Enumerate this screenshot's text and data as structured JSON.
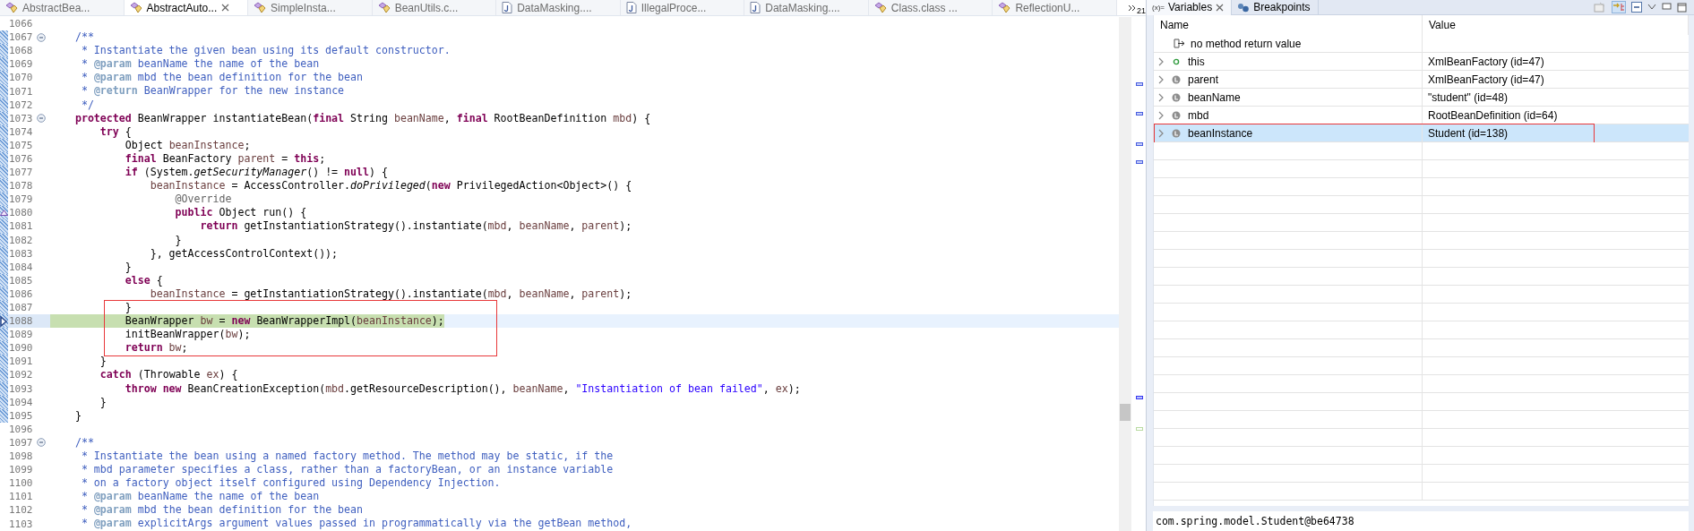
{
  "editor_tabs": [
    {
      "label": "AbstractBea...",
      "kind": "class",
      "selected": false
    },
    {
      "label": "AbstractAuto...",
      "kind": "class",
      "selected": true
    },
    {
      "label": "SimpleInsta...",
      "kind": "class",
      "selected": false
    },
    {
      "label": "BeanUtils.c...",
      "kind": "class",
      "selected": false
    },
    {
      "label": "DataMasking....",
      "kind": "java",
      "selected": false
    },
    {
      "label": "IllegalProce...",
      "kind": "java",
      "selected": false
    },
    {
      "label": "DataMasking....",
      "kind": "java",
      "selected": false
    },
    {
      "label": "Class.class ...",
      "kind": "class",
      "selected": false
    },
    {
      "label": "ReflectionU...",
      "kind": "class",
      "selected": false
    }
  ],
  "overflow_count": "21",
  "editor": {
    "lines": [
      {
        "number": "1066",
        "fold": false,
        "in_range": false,
        "current": false
      },
      {
        "number": "1067",
        "tokens": [
          {
            "kind": "comment",
            "text": "    /**"
          }
        ],
        "fold": true,
        "in_range": true,
        "current": false
      },
      {
        "number": "1068",
        "tokens": [
          {
            "kind": "comment",
            "text": "     * Instantiate the given bean using its default constructor."
          }
        ],
        "fold": false,
        "in_range": true,
        "current": false
      },
      {
        "number": "1069",
        "tokens": [
          {
            "kind": "comment",
            "text": "     * "
          },
          {
            "kind": "tag",
            "text": "@param"
          },
          {
            "kind": "comment",
            "text": " beanName the name of the bean"
          }
        ],
        "fold": false,
        "in_range": true,
        "current": false
      },
      {
        "number": "1070",
        "tokens": [
          {
            "kind": "comment",
            "text": "     * "
          },
          {
            "kind": "tag",
            "text": "@param"
          },
          {
            "kind": "comment",
            "text": " mbd the bean definition for the bean"
          }
        ],
        "fold": false,
        "in_range": true,
        "current": false
      },
      {
        "number": "1071",
        "tokens": [
          {
            "kind": "comment",
            "text": "     * "
          },
          {
            "kind": "tag",
            "text": "@return"
          },
          {
            "kind": "comment",
            "text": " BeanWrapper for the new instance"
          }
        ],
        "fold": false,
        "in_range": true,
        "current": false
      },
      {
        "number": "1072",
        "tokens": [
          {
            "kind": "comment",
            "text": "     */"
          }
        ],
        "fold": false,
        "in_range": true,
        "current": false
      },
      {
        "number": "1073",
        "tokens": [
          {
            "kind": "keyword",
            "text": "    protected"
          },
          {
            "kind": "plain",
            "text": " BeanWrapper instantiateBean("
          },
          {
            "kind": "keyword",
            "text": "final"
          },
          {
            "kind": "plain",
            "text": " String "
          },
          {
            "kind": "var",
            "text": "beanName"
          },
          {
            "kind": "plain",
            "text": ", "
          },
          {
            "kind": "keyword",
            "text": "final"
          },
          {
            "kind": "plain",
            "text": " RootBeanDefinition "
          },
          {
            "kind": "var",
            "text": "mbd"
          },
          {
            "kind": "plain",
            "text": ") {"
          }
        ],
        "fold": true,
        "in_range": true,
        "current": false
      },
      {
        "number": "1074",
        "tokens": [
          {
            "kind": "keyword",
            "text": "        try"
          },
          {
            "kind": "plain",
            "text": " {"
          }
        ],
        "fold": false,
        "in_range": true,
        "current": false
      },
      {
        "number": "1075",
        "tokens": [
          {
            "kind": "plain",
            "text": "            Object "
          },
          {
            "kind": "var",
            "text": "beanInstance"
          },
          {
            "kind": "plain",
            "text": ";"
          }
        ],
        "fold": false,
        "in_range": true,
        "current": false
      },
      {
        "number": "1076",
        "tokens": [
          {
            "kind": "keyword",
            "text": "            final"
          },
          {
            "kind": "plain",
            "text": " BeanFactory "
          },
          {
            "kind": "var",
            "text": "parent"
          },
          {
            "kind": "plain",
            "text": " = "
          },
          {
            "kind": "keyword",
            "text": "this"
          },
          {
            "kind": "plain",
            "text": ";"
          }
        ],
        "fold": false,
        "in_range": true,
        "current": false
      },
      {
        "number": "1077",
        "tokens": [
          {
            "kind": "keyword",
            "text": "            if"
          },
          {
            "kind": "plain",
            "text": " (System."
          },
          {
            "kind": "method",
            "text": "getSecurityManager"
          },
          {
            "kind": "plain",
            "text": "() != "
          },
          {
            "kind": "keyword",
            "text": "null"
          },
          {
            "kind": "plain",
            "text": ") {"
          }
        ],
        "fold": false,
        "in_range": true,
        "current": false
      },
      {
        "number": "1078",
        "tokens": [
          {
            "kind": "var",
            "text": "                beanInstance"
          },
          {
            "kind": "plain",
            "text": " = AccessController."
          },
          {
            "kind": "method",
            "text": "doPrivileged"
          },
          {
            "kind": "plain",
            "text": "("
          },
          {
            "kind": "keyword",
            "text": "new"
          },
          {
            "kind": "plain",
            "text": " PrivilegedAction<Object>() {"
          }
        ],
        "fold": false,
        "in_range": true,
        "current": false
      },
      {
        "number": "1079",
        "tokens": [
          {
            "kind": "annotation",
            "text": "                    @Override"
          }
        ],
        "fold": false,
        "in_range": true,
        "current": false
      },
      {
        "number": "1080",
        "tokens": [
          {
            "kind": "keyword",
            "text": "                    public"
          },
          {
            "kind": "plain",
            "text": " Object run() {"
          }
        ],
        "fold": false,
        "in_range": true,
        "current": false,
        "override_marker": true
      },
      {
        "number": "1081",
        "tokens": [
          {
            "kind": "keyword",
            "text": "                        return"
          },
          {
            "kind": "plain",
            "text": " getInstantiationStrategy().instantiate("
          },
          {
            "kind": "var",
            "text": "mbd"
          },
          {
            "kind": "plain",
            "text": ", "
          },
          {
            "kind": "var",
            "text": "beanName"
          },
          {
            "kind": "plain",
            "text": ", "
          },
          {
            "kind": "var",
            "text": "parent"
          },
          {
            "kind": "plain",
            "text": ");"
          }
        ],
        "fold": false,
        "in_range": true,
        "current": false
      },
      {
        "number": "1082",
        "tokens": [
          {
            "kind": "plain",
            "text": "                    }"
          }
        ],
        "fold": false,
        "in_range": true,
        "current": false
      },
      {
        "number": "1083",
        "tokens": [
          {
            "kind": "plain",
            "text": "                }, getAccessControlContext());"
          }
        ],
        "fold": false,
        "in_range": true,
        "current": false
      },
      {
        "number": "1084",
        "tokens": [
          {
            "kind": "plain",
            "text": "            }"
          }
        ],
        "fold": false,
        "in_range": true,
        "current": false
      },
      {
        "number": "1085",
        "tokens": [
          {
            "kind": "keyword",
            "text": "            else"
          },
          {
            "kind": "plain",
            "text": " {"
          }
        ],
        "fold": false,
        "in_range": true,
        "current": false
      },
      {
        "number": "1086",
        "tokens": [
          {
            "kind": "var",
            "text": "                beanInstance"
          },
          {
            "kind": "plain",
            "text": " = getInstantiationStrategy().instantiate("
          },
          {
            "kind": "var",
            "text": "mbd"
          },
          {
            "kind": "plain",
            "text": ", "
          },
          {
            "kind": "var",
            "text": "beanName"
          },
          {
            "kind": "plain",
            "text": ", "
          },
          {
            "kind": "var",
            "text": "parent"
          },
          {
            "kind": "plain",
            "text": ");"
          }
        ],
        "fold": false,
        "in_range": true,
        "current": false
      },
      {
        "number": "1087",
        "tokens": [
          {
            "kind": "plain",
            "text": "            }"
          }
        ],
        "fold": false,
        "in_range": true,
        "current": false,
        "boxed": true
      },
      {
        "number": "1088",
        "tokens": [
          {
            "kind": "plain",
            "text": "            BeanWrapper "
          },
          {
            "kind": "var",
            "text": "bw"
          },
          {
            "kind": "plain",
            "text": " = "
          },
          {
            "kind": "keyword",
            "text": "new"
          },
          {
            "kind": "plain",
            "text": " BeanWrapperImpl("
          },
          {
            "kind": "var",
            "text": "beanInstance"
          },
          {
            "kind": "plain",
            "text": ");"
          }
        ],
        "fold": false,
        "in_range": true,
        "current": true,
        "boxed": true
      },
      {
        "number": "1089",
        "tokens": [
          {
            "kind": "plain",
            "text": "            initBeanWrapper("
          },
          {
            "kind": "var",
            "text": "bw"
          },
          {
            "kind": "plain",
            "text": ");"
          }
        ],
        "fold": false,
        "in_range": true,
        "current": false,
        "boxed": true
      },
      {
        "number": "1090",
        "tokens": [
          {
            "kind": "keyword",
            "text": "            return"
          },
          {
            "kind": "var",
            "text": " bw"
          },
          {
            "kind": "plain",
            "text": ";"
          }
        ],
        "fold": false,
        "in_range": true,
        "current": false,
        "boxed": true
      },
      {
        "number": "1091",
        "tokens": [
          {
            "kind": "plain",
            "text": "        }"
          }
        ],
        "fold": false,
        "in_range": true,
        "current": false
      },
      {
        "number": "1092",
        "tokens": [
          {
            "kind": "keyword",
            "text": "        catch"
          },
          {
            "kind": "plain",
            "text": " (Throwable "
          },
          {
            "kind": "var",
            "text": "ex"
          },
          {
            "kind": "plain",
            "text": ") {"
          }
        ],
        "fold": false,
        "in_range": true,
        "current": false
      },
      {
        "number": "1093",
        "tokens": [
          {
            "kind": "keyword",
            "text": "            throw new"
          },
          {
            "kind": "plain",
            "text": " BeanCreationException("
          },
          {
            "kind": "var",
            "text": "mbd"
          },
          {
            "kind": "plain",
            "text": ".getResourceDescription(), "
          },
          {
            "kind": "var",
            "text": "beanName"
          },
          {
            "kind": "plain",
            "text": ", "
          },
          {
            "kind": "string",
            "text": "\"Instantiation of bean failed\""
          },
          {
            "kind": "plain",
            "text": ", "
          },
          {
            "kind": "var",
            "text": "ex"
          },
          {
            "kind": "plain",
            "text": ");"
          }
        ],
        "fold": false,
        "in_range": true,
        "current": false
      },
      {
        "number": "1094",
        "tokens": [
          {
            "kind": "plain",
            "text": "        }"
          }
        ],
        "fold": false,
        "in_range": true,
        "current": false
      },
      {
        "number": "1095",
        "tokens": [
          {
            "kind": "plain",
            "text": "    }"
          }
        ],
        "fold": false,
        "in_range": true,
        "current": false
      },
      {
        "number": "1096",
        "fold": false,
        "in_range": false,
        "current": false
      },
      {
        "number": "1097",
        "tokens": [
          {
            "kind": "comment",
            "text": "    /**"
          }
        ],
        "fold": true,
        "in_range": false,
        "current": false
      },
      {
        "number": "1098",
        "tokens": [
          {
            "kind": "comment",
            "text": "     * Instantiate the bean using a named factory method. The method may be static, if the"
          }
        ],
        "fold": false,
        "in_range": false,
        "current": false
      },
      {
        "number": "1099",
        "tokens": [
          {
            "kind": "comment",
            "text": "     * mbd parameter specifies a class, rather than a factoryBean, or an instance variable"
          }
        ],
        "fold": false,
        "in_range": false,
        "current": false
      },
      {
        "number": "1100",
        "tokens": [
          {
            "kind": "comment",
            "text": "     * on a factory object itself configured using Dependency Injection."
          }
        ],
        "fold": false,
        "in_range": false,
        "current": false
      },
      {
        "number": "1101",
        "tokens": [
          {
            "kind": "comment",
            "text": "     * "
          },
          {
            "kind": "tag",
            "text": "@param"
          },
          {
            "kind": "comment",
            "text": " beanName the name of the bean"
          }
        ],
        "fold": false,
        "in_range": false,
        "current": false
      },
      {
        "number": "1102",
        "tokens": [
          {
            "kind": "comment",
            "text": "     * "
          },
          {
            "kind": "tag",
            "text": "@param"
          },
          {
            "kind": "comment",
            "text": " mbd the bean definition for the bean"
          }
        ],
        "fold": false,
        "in_range": false,
        "current": false
      },
      {
        "number": "1103",
        "tokens": [
          {
            "kind": "comment",
            "text": "     * "
          },
          {
            "kind": "tag",
            "text": "@param"
          },
          {
            "kind": "comment",
            "text": " explicitArgs argument values passed in programmatically via the getBean method,"
          }
        ],
        "fold": false,
        "in_range": false,
        "current": false
      }
    ]
  },
  "debug_panel": {
    "tabs": [
      {
        "label": "Variables",
        "icon": "(x)=",
        "selected": true
      },
      {
        "label": "Breakpoints",
        "selected": false
      }
    ],
    "columns": [
      "Name",
      "Value"
    ],
    "variables": [
      {
        "name": "no method return value",
        "kind": "return",
        "expandable": false,
        "selected": false
      },
      {
        "name": "this",
        "value": "XmlBeanFactory  (id=47)",
        "kind": "field",
        "expandable": true,
        "selected": false
      },
      {
        "name": "parent",
        "value": "XmlBeanFactory  (id=47)",
        "kind": "local",
        "expandable": true,
        "selected": false
      },
      {
        "name": "beanName",
        "value": "\"student\" (id=48)",
        "kind": "local",
        "expandable": true,
        "selected": false
      },
      {
        "name": "mbd",
        "value": "RootBeanDefinition  (id=64)",
        "kind": "local",
        "expandable": true,
        "selected": false
      },
      {
        "name": "beanInstance",
        "value": "Student  (id=138)",
        "kind": "local",
        "expandable": true,
        "selected": true,
        "boxed": true
      }
    ],
    "detail": "com.spring.model.Student@be64738"
  }
}
